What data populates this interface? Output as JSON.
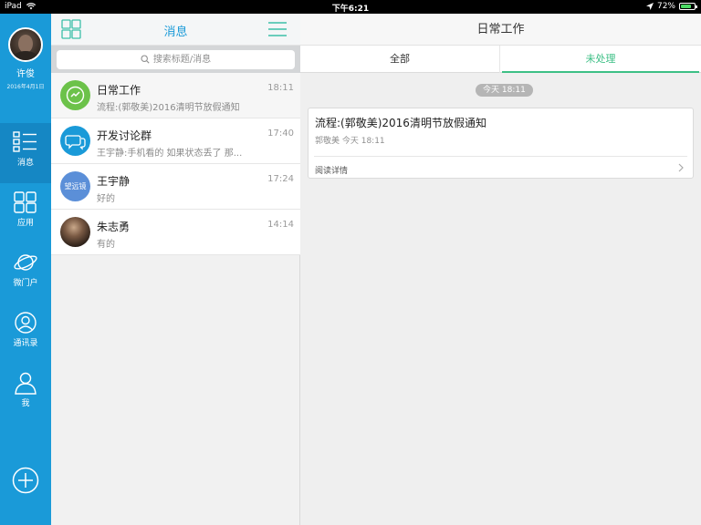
{
  "statusbar": {
    "device": "iPad",
    "time": "下午6:21",
    "battery": "72%",
    "battery_level": 0.72
  },
  "colors": {
    "rail": "#1a9ad8",
    "rail_active": "#1587c4",
    "accent_green": "#3cbf85",
    "title_blue": "#1a9ad8"
  },
  "profile": {
    "name": "许俊",
    "date": "2016年4月1日"
  },
  "nav": [
    {
      "label": "消息",
      "icon": "message-list-icon",
      "active": true
    },
    {
      "label": "应用",
      "icon": "apps-grid-icon"
    },
    {
      "label": "微门户",
      "icon": "planet-icon"
    },
    {
      "label": "通讯录",
      "icon": "contact-icon"
    },
    {
      "label": "我",
      "icon": "person-icon"
    }
  ],
  "midpanel": {
    "title": "消息",
    "search_placeholder": "搜索标题/消息",
    "conversations": [
      {
        "name": "日常工作",
        "time": "18:11",
        "preview": "流程:(郭敬美)2016清明节放假通知",
        "icon": "workflow-icon"
      },
      {
        "name": "开发讨论群",
        "time": "17:40",
        "preview": "王宇静:手机看的  如果状态丢了    那...",
        "icon": "group-chat-icon"
      },
      {
        "name": "王宇静",
        "time": "17:24",
        "preview": "好的",
        "avatar_text": "望远镜"
      },
      {
        "name": "朱志勇",
        "time": "14:14",
        "preview": "有的",
        "icon": "photo-avatar"
      }
    ]
  },
  "detail": {
    "title": "日常工作",
    "tabs": [
      {
        "label": "全部"
      },
      {
        "label": "未处理",
        "active": true
      }
    ],
    "time_pill": "今天 18:11",
    "card": {
      "title": "流程:(郭敬美)2016清明节放假通知",
      "meta": "郭敬美 今天 18:11",
      "action": "阅读详情"
    }
  }
}
